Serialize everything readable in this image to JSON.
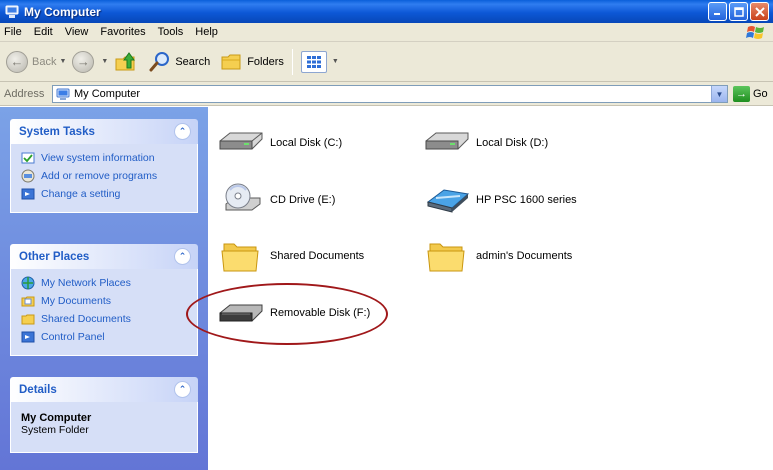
{
  "window": {
    "title": "My Computer",
    "controls": [
      "minimize",
      "maximize",
      "close"
    ]
  },
  "menu": [
    "File",
    "Edit",
    "View",
    "Favorites",
    "Tools",
    "Help"
  ],
  "toolbar": {
    "back": "Back",
    "search": "Search",
    "folders": "Folders"
  },
  "address": {
    "label": "Address",
    "value": "My Computer",
    "go": "Go"
  },
  "taskpane": {
    "system_tasks": {
      "title": "System Tasks",
      "items": [
        "View system information",
        "Add or remove programs",
        "Change a setting"
      ]
    },
    "other_places": {
      "title": "Other Places",
      "items": [
        "My Network Places",
        "My Documents",
        "Shared Documents",
        "Control Panel"
      ]
    },
    "details": {
      "title": "Details",
      "name": "My Computer",
      "type": "System Folder"
    }
  },
  "items": [
    {
      "label": "Local Disk (C:)",
      "icon": "hard-drive-icon"
    },
    {
      "label": "Local Disk (D:)",
      "icon": "hard-drive-icon"
    },
    {
      "label": "CD Drive (E:)",
      "icon": "cd-drive-icon"
    },
    {
      "label": "HP PSC 1600 series",
      "icon": "scanner-icon"
    },
    {
      "label": "Shared Documents",
      "icon": "folder-icon"
    },
    {
      "label": "admin's Documents",
      "icon": "folder-icon"
    },
    {
      "label": "Removable Disk (F:)",
      "icon": "removable-disk-icon"
    }
  ],
  "colors": {
    "titlebar": "#0d58d6",
    "taskpane": "#7ba2e7",
    "link": "#215dc6",
    "highlight_ring": "#a0181a"
  }
}
